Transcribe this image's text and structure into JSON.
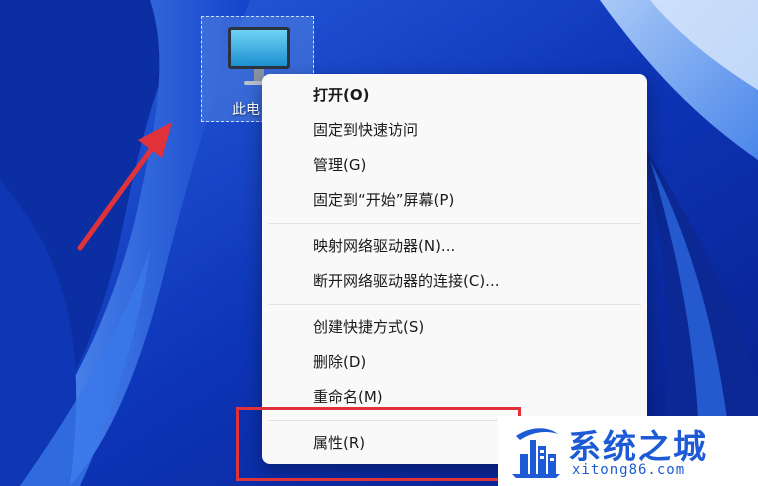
{
  "desktop": {
    "icon_label": "此电"
  },
  "context_menu": {
    "groups": [
      [
        {
          "label": "打开(O)",
          "bold": true
        },
        {
          "label": "固定到快速访问"
        },
        {
          "label": "管理(G)"
        },
        {
          "label": "固定到“开始”屏幕(P)"
        }
      ],
      [
        {
          "label": "映射网络驱动器(N)..."
        },
        {
          "label": "断开网络驱动器的连接(C)..."
        }
      ],
      [
        {
          "label": "创建快捷方式(S)"
        },
        {
          "label": "删除(D)"
        },
        {
          "label": "重命名(M)"
        }
      ],
      [
        {
          "label": "属性(R)"
        }
      ]
    ]
  },
  "watermark": {
    "title": "系统之城",
    "url": "xitong86.com"
  },
  "colors": {
    "highlight_border": "#e0323a",
    "arrow": "#e0323a",
    "watermark_brand": "#1d5bd6"
  }
}
